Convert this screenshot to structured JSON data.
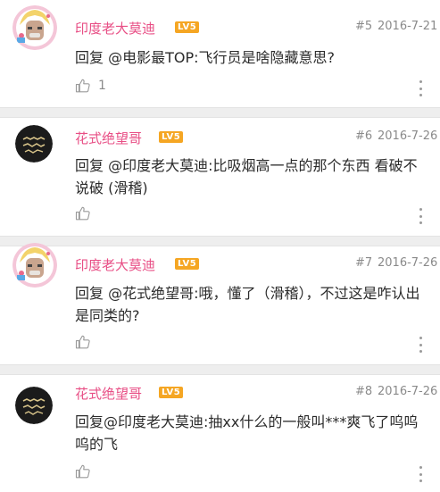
{
  "posts": [
    {
      "username": "印度老大莫迪",
      "level": "LV5",
      "floor": "#5",
      "date": "2016-7-21",
      "content": "回复 @电影最TOP:飞行员是啥隐藏意思?",
      "likes": "1"
    },
    {
      "username": "花式绝望哥",
      "level": "LV5",
      "floor": "#6",
      "date": "2016-7-26",
      "content": "回复 @印度老大莫迪:比吸烟高一点的那个东西 看破不说破 (滑稽)",
      "likes": ""
    },
    {
      "username": "印度老大莫迪",
      "level": "LV5",
      "floor": "#7",
      "date": "2016-7-26",
      "content": "回复 @花式绝望哥:哦，懂了（滑稽），不过这是咋认出是同类的?",
      "likes": ""
    },
    {
      "username": "花式绝望哥",
      "level": "LV5",
      "floor": "#8",
      "date": "2016-7-26",
      "content": "回复@印度老大莫迪:抽xx什么的一般叫***爽飞了呜呜呜的飞",
      "likes": ""
    }
  ],
  "colors": {
    "username": "#e84e85",
    "level_badge": "#f5a623",
    "meta_text": "#8a8a8a",
    "divider": "#eeeeee"
  },
  "icons": {
    "like": "thumbs-up-icon",
    "more": "more-vertical-icon",
    "avatar_a": "anime-avatar-icon",
    "avatar_b": "viva-la-vida-avatar-icon"
  }
}
